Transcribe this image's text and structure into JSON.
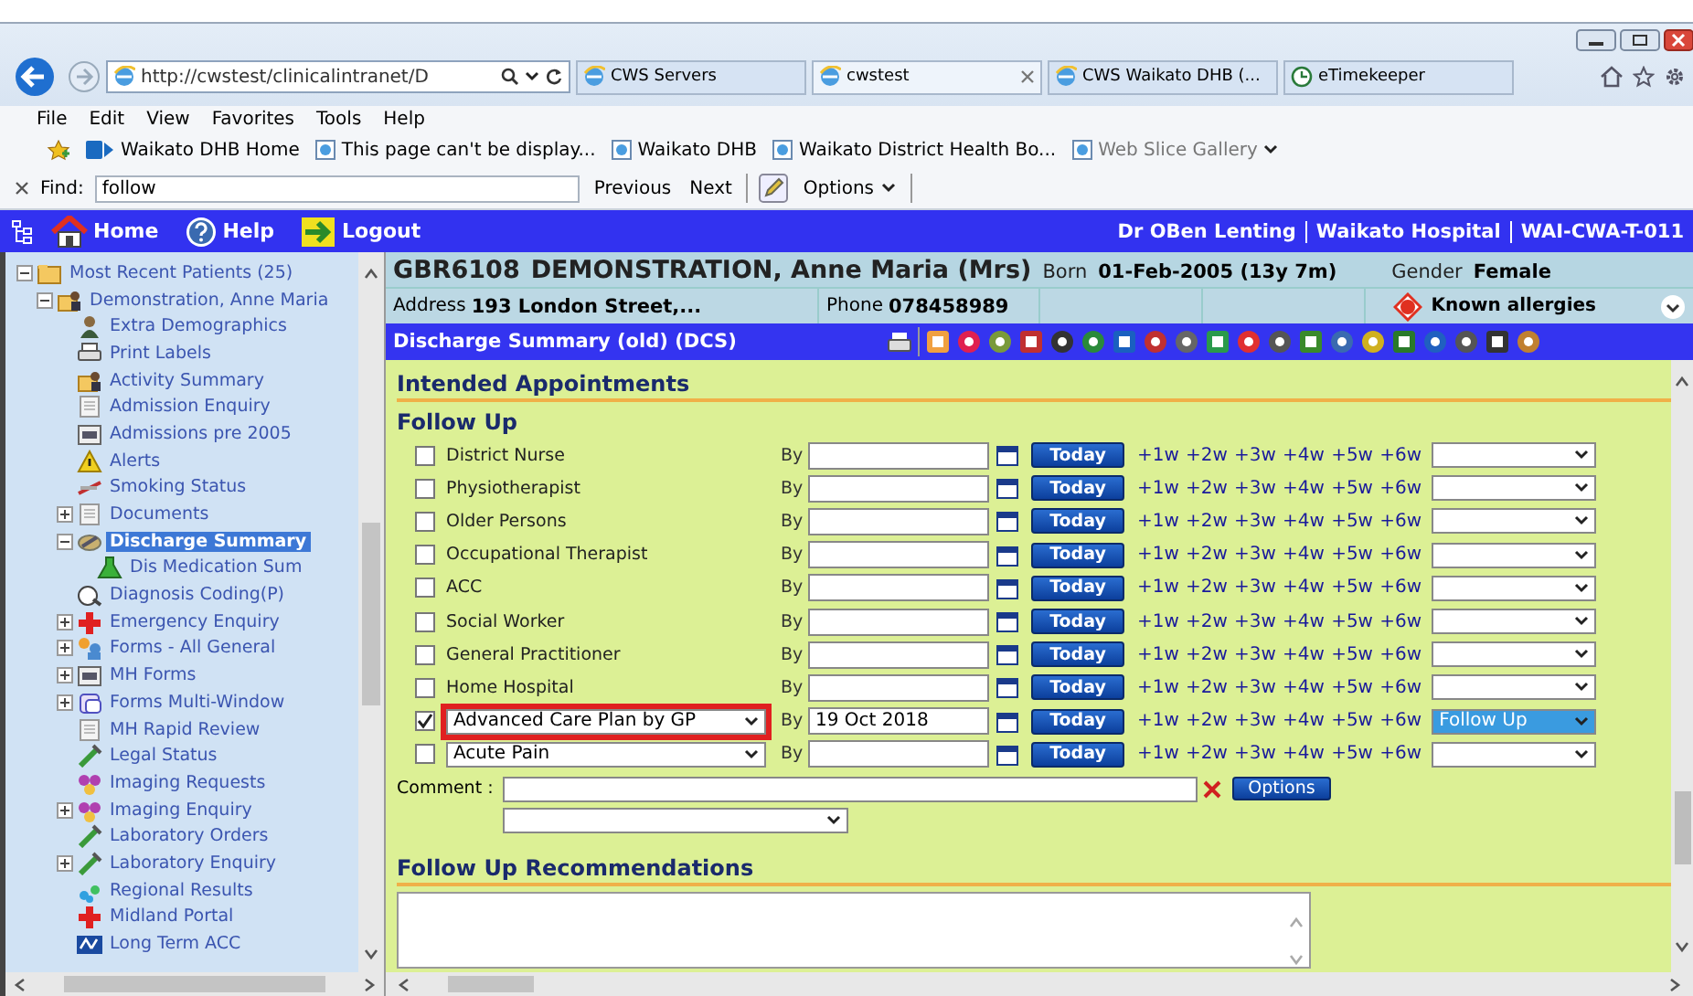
{
  "browser": {
    "address": "http://cwstest/clinicalintranet/D",
    "tabs": [
      {
        "label": "CWS Servers",
        "selected": false,
        "closable": false
      },
      {
        "label": "cwstest",
        "selected": true,
        "closable": true
      },
      {
        "label": "CWS Waikato DHB (...",
        "selected": false,
        "closable": false
      },
      {
        "label": "eTimekeeper",
        "selected": false,
        "closable": false
      }
    ],
    "menu": [
      "File",
      "Edit",
      "View",
      "Favorites",
      "Tools",
      "Help"
    ],
    "favorites": [
      {
        "label": "Waikato DHB Home",
        "disabled": false
      },
      {
        "label": "This page can't be display...",
        "disabled": false
      },
      {
        "label": "Waikato DHB",
        "disabled": false
      },
      {
        "label": "Waikato District Health Bo...",
        "disabled": false
      },
      {
        "label": "Web Slice Gallery",
        "disabled": true
      }
    ],
    "find": {
      "label": "Find:",
      "value": "follow",
      "buttons": [
        "Previous",
        "Next"
      ],
      "options": "Options"
    }
  },
  "app_bar": {
    "items": [
      "Home",
      "Help",
      "Logout"
    ],
    "user_info": [
      "Dr OBen Lenting",
      "Waikato Hospital",
      "WAI-CWA-T-011"
    ]
  },
  "sidebar": {
    "tree": [
      {
        "label": "Most Recent Patients (25)",
        "expanded": true,
        "selected": false,
        "children": [
          {
            "label": "Demonstration, Anne Maria",
            "expanded": true,
            "selected": false,
            "children": [
              {
                "label": "Extra Demographics",
                "selected": false
              },
              {
                "label": "Print Labels",
                "selected": false
              },
              {
                "label": "Activity Summary",
                "selected": false
              },
              {
                "label": "Admission Enquiry",
                "selected": false
              },
              {
                "label": "Admissions pre 2005",
                "selected": false
              },
              {
                "label": "Alerts",
                "selected": false
              },
              {
                "label": "Smoking Status",
                "selected": false
              },
              {
                "label": "Documents",
                "expanded": false,
                "selected": false
              },
              {
                "label": "Discharge Summary",
                "expanded": true,
                "selected": true,
                "children": [
                  {
                    "label": "Dis Medication Sum",
                    "selected": false
                  }
                ]
              },
              {
                "label": "Diagnosis Coding(P)",
                "selected": false
              },
              {
                "label": "Emergency Enquiry",
                "expanded": false,
                "selected": false
              },
              {
                "label": "Forms - All General",
                "expanded": false,
                "selected": false
              },
              {
                "label": "MH Forms",
                "expanded": false,
                "selected": false
              },
              {
                "label": "Forms Multi-Window",
                "expanded": false,
                "selected": false
              },
              {
                "label": "MH Rapid Review",
                "selected": false
              },
              {
                "label": "Legal Status",
                "selected": false
              },
              {
                "label": "Imaging Requests",
                "selected": false
              },
              {
                "label": "Imaging Enquiry",
                "expanded": false,
                "selected": false
              },
              {
                "label": "Laboratory Orders",
                "selected": false
              },
              {
                "label": "Laboratory Enquiry",
                "expanded": false,
                "selected": false
              },
              {
                "label": "Regional Results",
                "selected": false
              },
              {
                "label": "Midland Portal",
                "selected": false
              },
              {
                "label": "Long Term ACC",
                "selected": false
              }
            ]
          }
        ]
      }
    ]
  },
  "patient": {
    "nhi": "GBR6108",
    "name": "DEMONSTRATION, Anne Maria (Mrs)",
    "born_label": "Born",
    "born": "01-Feb-2005 (13y 7m)",
    "gender_label": "Gender",
    "gender": "Female",
    "address_label": "Address",
    "address": "193 London Street,...",
    "phone_label": "Phone",
    "phone": "078458989",
    "allergies": "Known allergies"
  },
  "form_bar": {
    "title": "Discharge Summary (old) (DCS)"
  },
  "content": {
    "section_title": "Intended Appointments",
    "subsection_title": "Follow Up",
    "rows": [
      {
        "kind": "checkbox",
        "label": "District Nurse",
        "checked": false,
        "highlighted": false,
        "by": "By",
        "today": "Today",
        "shortcuts": [
          "+1w",
          "+2w",
          "+3w",
          "+4w",
          "+5w",
          "+6w"
        ]
      },
      {
        "kind": "checkbox",
        "label": "Physiotherapist",
        "checked": false,
        "highlighted": false,
        "by": "By",
        "today": "Today",
        "shortcuts": [
          "+1w",
          "+2w",
          "+3w",
          "+4w",
          "+5w",
          "+6w"
        ]
      },
      {
        "kind": "checkbox",
        "label": "Older Persons",
        "checked": false,
        "highlighted": false,
        "by": "By",
        "today": "Today",
        "shortcuts": [
          "+1w",
          "+2w",
          "+3w",
          "+4w",
          "+5w",
          "+6w"
        ]
      },
      {
        "kind": "checkbox",
        "label": "Occupational Therapist",
        "checked": false,
        "highlighted": false,
        "by": "By",
        "today": "Today",
        "shortcuts": [
          "+1w",
          "+2w",
          "+3w",
          "+4w",
          "+5w",
          "+6w"
        ]
      },
      {
        "kind": "checkbox",
        "label": "ACC",
        "checked": false,
        "highlighted": false,
        "by": "By",
        "today": "Today",
        "shortcuts": [
          "+1w",
          "+2w",
          "+3w",
          "+4w",
          "+5w",
          "+6w"
        ]
      },
      {
        "kind": "checkbox",
        "label": "Social Worker",
        "checked": false,
        "highlighted": false,
        "by": "By",
        "today": "Today",
        "shortcuts": [
          "+1w",
          "+2w",
          "+3w",
          "+4w",
          "+5w",
          "+6w"
        ]
      },
      {
        "kind": "checkbox",
        "label": "General Practitioner",
        "checked": false,
        "highlighted": false,
        "by": "By",
        "today": "Today",
        "shortcuts": [
          "+1w",
          "+2w",
          "+3w",
          "+4w",
          "+5w",
          "+6w"
        ]
      },
      {
        "kind": "checkbox",
        "label": "Home Hospital",
        "checked": false,
        "highlighted": false,
        "by": "By",
        "today": "Today",
        "shortcuts": [
          "+1w",
          "+2w",
          "+3w",
          "+4w",
          "+5w",
          "+6w"
        ]
      },
      {
        "kind": "select",
        "label": "Advanced Care Plan by GP",
        "checked": true,
        "highlighted": true,
        "by": "By",
        "date": "19 Oct 2018",
        "today": "Today",
        "shortcuts": [
          "+1w",
          "+2w",
          "+3w",
          "+4w",
          "+5w",
          "+6w"
        ],
        "status": "Follow Up",
        "status_selected": true
      },
      {
        "kind": "select",
        "label": "Acute Pain",
        "checked": false,
        "highlighted": false,
        "by": "By",
        "today": "Today",
        "shortcuts": [
          "+1w",
          "+2w",
          "+3w",
          "+4w",
          "+5w",
          "+6w"
        ]
      }
    ],
    "comment_label": "Comment :",
    "options_button": "Options",
    "recommendations_title": "Follow Up Recommendations"
  }
}
